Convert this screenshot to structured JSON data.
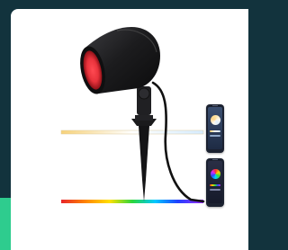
{
  "colors": {
    "background": "#12333d",
    "accent_bar": "#2ecc8e",
    "card": "#ffffff",
    "product_body": "#1c1c1e",
    "lens_glow": "#e8323b"
  },
  "icons": {
    "product": "spike-spotlight-icon",
    "phone_white": "phone-app-white-tuning-icon",
    "phone_rgb": "phone-app-color-wheel-icon"
  },
  "light_bands": {
    "white_tunable": [
      "#f7d27a",
      "#ffffff",
      "#d6ecff"
    ],
    "rgb": [
      "#e8242a",
      "#ff8a00",
      "#ffe000",
      "#2bd63c",
      "#00c8ff",
      "#2040ff",
      "#9b2cff"
    ]
  }
}
